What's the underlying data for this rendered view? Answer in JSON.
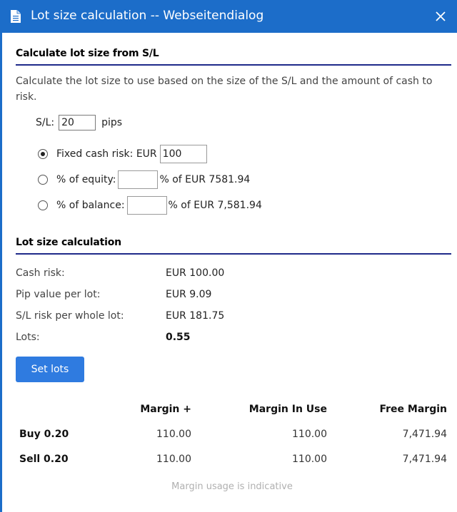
{
  "window": {
    "title": "Lot size calculation -- Webseitendialog",
    "title_icon": "document-icon",
    "close_glyph": "✕",
    "accent_color": "#1c6dc9"
  },
  "calc_from_sl": {
    "header": "Calculate lot size from S/L",
    "description": "Calculate the lot size to use based on the size of the S/L and the amount of cash to risk.",
    "sl_label": "S/L:",
    "sl_value": "20",
    "sl_unit": "pips",
    "options": [
      {
        "label": "Fixed cash risk: EUR",
        "value": "100",
        "suffix": "",
        "checked": true
      },
      {
        "label": "% of equity:",
        "value": "",
        "suffix": "% of EUR 7581.94",
        "checked": false
      },
      {
        "label": "% of balance:",
        "value": "",
        "suffix": "% of EUR 7,581.94",
        "checked": false
      }
    ]
  },
  "lot_calc": {
    "header": "Lot size calculation",
    "rows": [
      {
        "label": "Cash risk:",
        "value": "EUR 100.00"
      },
      {
        "label": "Pip value per lot:",
        "value": "EUR 9.09"
      },
      {
        "label": "S/L risk per whole lot:",
        "value": "EUR 181.75"
      },
      {
        "label": "Lots:",
        "value": "0.55"
      }
    ],
    "set_lots_label": "Set lots",
    "button_color": "#2f7be0"
  },
  "margin_table": {
    "columns": [
      "Margin +",
      "Margin In Use",
      "Free Margin"
    ],
    "rows": [
      {
        "label": "Buy 0.20",
        "margin_plus": "110.00",
        "margin_in_use": "110.00",
        "free_margin": "7,471.94"
      },
      {
        "label": "Sell 0.20",
        "margin_plus": "110.00",
        "margin_in_use": "110.00",
        "free_margin": "7,471.94"
      }
    ],
    "footnote": "Margin usage is indicative"
  }
}
